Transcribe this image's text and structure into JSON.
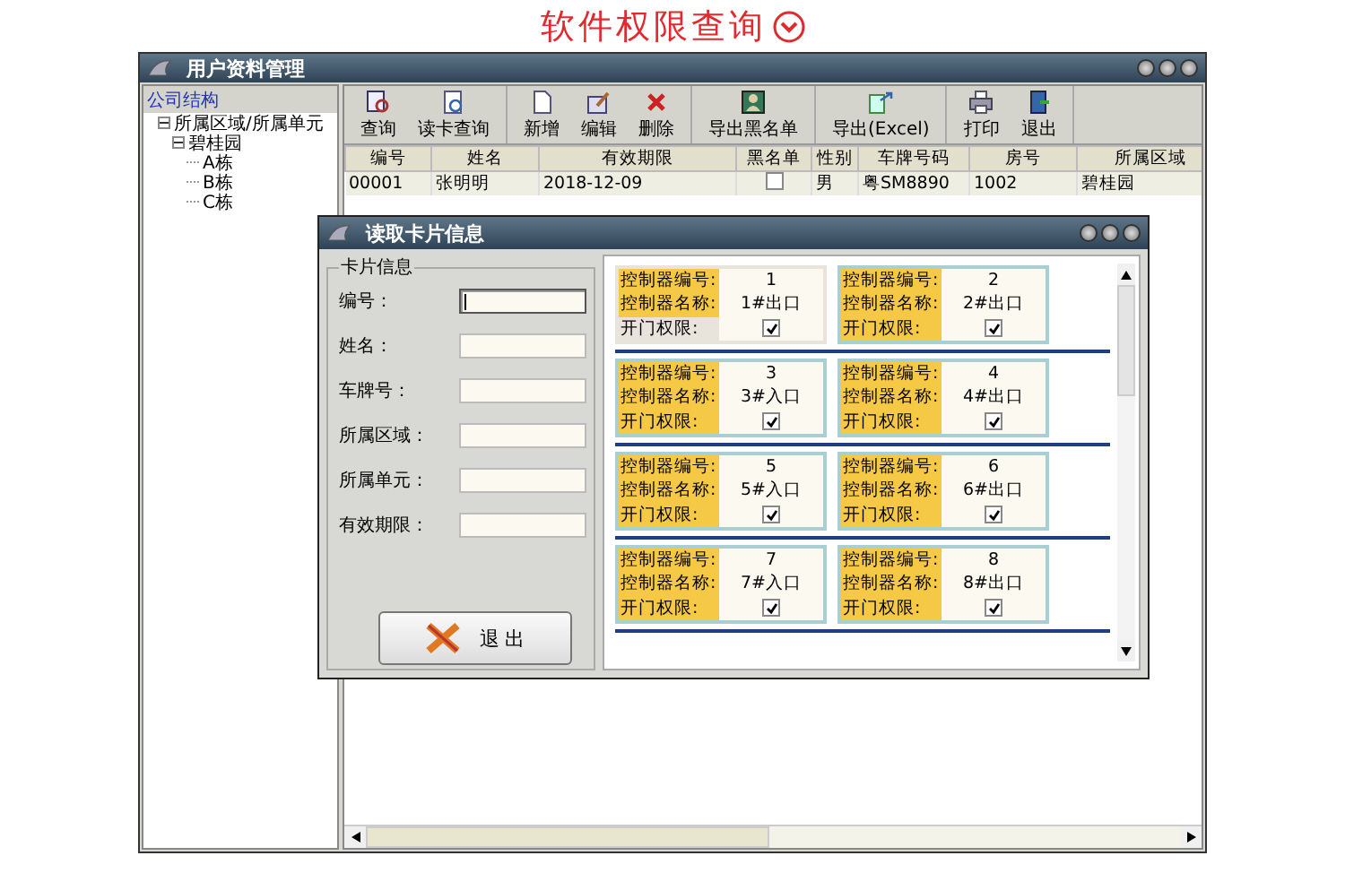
{
  "heading": {
    "text": "软件权限查询"
  },
  "window": {
    "title": "用户资料管理"
  },
  "sidebar": {
    "title": "公司结构",
    "tree": [
      {
        "label": "所属区域/所属单元",
        "expanded": true,
        "children": [
          {
            "label": "碧桂园",
            "expanded": true,
            "children": [
              {
                "label": "A栋"
              },
              {
                "label": "B栋"
              },
              {
                "label": "C栋"
              }
            ]
          }
        ]
      }
    ]
  },
  "toolbar": {
    "groups": [
      [
        {
          "kind": "search",
          "label": "查询"
        },
        {
          "kind": "card",
          "label": "读卡查询"
        }
      ],
      [
        {
          "kind": "new",
          "label": "新增"
        },
        {
          "kind": "edit",
          "label": "编辑"
        },
        {
          "kind": "delete",
          "label": "删除"
        }
      ],
      [
        {
          "kind": "blacklist",
          "label": "导出黑名单"
        }
      ],
      [
        {
          "kind": "excel",
          "label": "导出(Excel)"
        }
      ],
      [
        {
          "kind": "print",
          "label": "打印"
        },
        {
          "kind": "exit",
          "label": "退出"
        }
      ]
    ]
  },
  "table": {
    "columns": [
      "编号",
      "姓名",
      "有效期限",
      "黑名单",
      "性别",
      "车牌号码",
      "房号",
      "所属区域"
    ],
    "rows": [
      {
        "id": "00001",
        "name": "张明明",
        "expiry": "2018-12-09",
        "blacklisted": false,
        "gender": "男",
        "plate": "粤SM8890",
        "room": "1002",
        "area": "碧桂园"
      }
    ]
  },
  "dialog": {
    "title": "读取卡片信息",
    "group_title": "卡片信息",
    "fields": [
      {
        "label": "编号：",
        "focused": true
      },
      {
        "label": "姓名：",
        "focused": false
      },
      {
        "label": "车牌号：",
        "focused": false
      },
      {
        "label": "所属区域：",
        "focused": false
      },
      {
        "label": "所属单元：",
        "focused": false
      },
      {
        "label": "有效期限：",
        "focused": false
      }
    ],
    "exit_button": "退  出",
    "controllers": [
      {
        "labels": [
          "控制器编号:",
          "控制器名称:",
          "开门权限:"
        ],
        "number": "1",
        "name": "1#出口",
        "permitted": true,
        "selected": true
      },
      {
        "labels": [
          "控制器编号:",
          "控制器名称:",
          "开门权限:"
        ],
        "number": "2",
        "name": "2#出口",
        "permitted": true,
        "selected": false
      },
      {
        "labels": [
          "控制器编号:",
          "控制器名称:",
          "开门权限:"
        ],
        "number": "3",
        "name": "3#入口",
        "permitted": true,
        "selected": false
      },
      {
        "labels": [
          "控制器编号:",
          "控制器名称:",
          "开门权限:"
        ],
        "number": "4",
        "name": "4#出口",
        "permitted": true,
        "selected": false
      },
      {
        "labels": [
          "控制器编号:",
          "控制器名称:",
          "开门权限:"
        ],
        "number": "5",
        "name": "5#入口",
        "permitted": true,
        "selected": false
      },
      {
        "labels": [
          "控制器编号:",
          "控制器名称:",
          "开门权限:"
        ],
        "number": "6",
        "name": "6#出口",
        "permitted": true,
        "selected": false
      },
      {
        "labels": [
          "控制器编号:",
          "控制器名称:",
          "开门权限:"
        ],
        "number": "7",
        "name": "7#入口",
        "permitted": true,
        "selected": false
      },
      {
        "labels": [
          "控制器编号:",
          "控制器名称:",
          "开门权限:"
        ],
        "number": "8",
        "name": "8#出口",
        "permitted": true,
        "selected": false
      }
    ]
  }
}
